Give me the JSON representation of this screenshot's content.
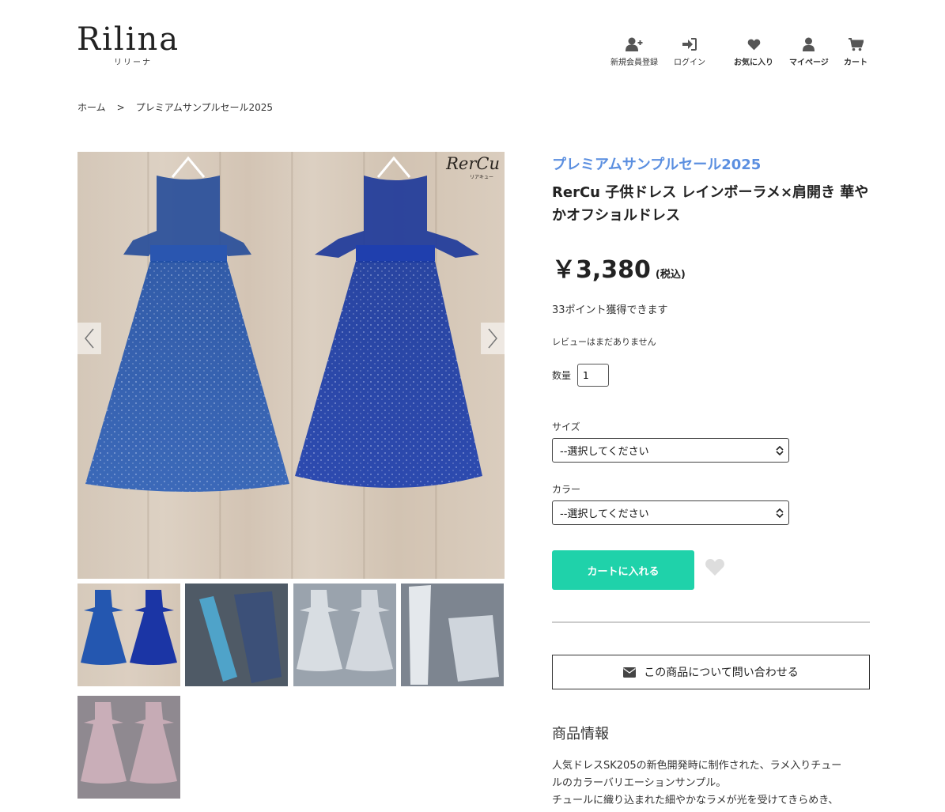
{
  "header": {
    "logo_text": "Rilina",
    "logo_sub": "リリーナ",
    "nav": [
      {
        "label": "新規会員登録",
        "icon": "user-plus-icon"
      },
      {
        "label": "ログイン",
        "icon": "sign-in-icon"
      },
      {
        "label": "お気に入り",
        "icon": "heart-icon"
      },
      {
        "label": "マイページ",
        "icon": "user-icon"
      },
      {
        "label": "カート",
        "icon": "cart-icon"
      }
    ]
  },
  "breadcrumb": {
    "home": "ホーム",
    "separator": ">",
    "current": "プレミアムサンプルセール2025"
  },
  "gallery": {
    "watermark": "RerCu",
    "watermark_sub": "リアキュー",
    "thumbnails": [
      {
        "name": "thumb-blue-dresses",
        "selected": true
      },
      {
        "name": "thumb-blue-ribbon-tulle"
      },
      {
        "name": "thumb-white-dresses"
      },
      {
        "name": "thumb-white-ribbon-tulle"
      },
      {
        "name": "thumb-pink-dresses"
      }
    ]
  },
  "product": {
    "category": "プレミアムサンプルセール2025",
    "title": "RerCu 子供ドレス レインボーラメ×肩開き 華やかオフショルドレス",
    "price": "￥3,380",
    "tax_note": "(税込)",
    "points": "33ポイント獲得できます",
    "review": "レビューはまだありません",
    "quantity_label": "数量",
    "quantity_value": "1",
    "size_label": "サイズ",
    "size_select": "--選択してください",
    "color_label": "カラー",
    "color_select": "--選択してください",
    "cart_button": "カートに入れる",
    "inquiry_button": "この商品について問い合わせる",
    "info_heading": "商品情報",
    "description": [
      "人気ドレスSK205の新色開発時に制作された、ラメ入りチュー",
      "ルのカラーバリエーションサンプル。",
      "チュールに織り込まれた細やかなラメが光を受けてきらめき、"
    ]
  },
  "colors": {
    "accent_blue": "#5b8fe0",
    "cart_green": "#1fd2aa",
    "icon_gray": "#555555",
    "heart_light": "#dddddd"
  }
}
